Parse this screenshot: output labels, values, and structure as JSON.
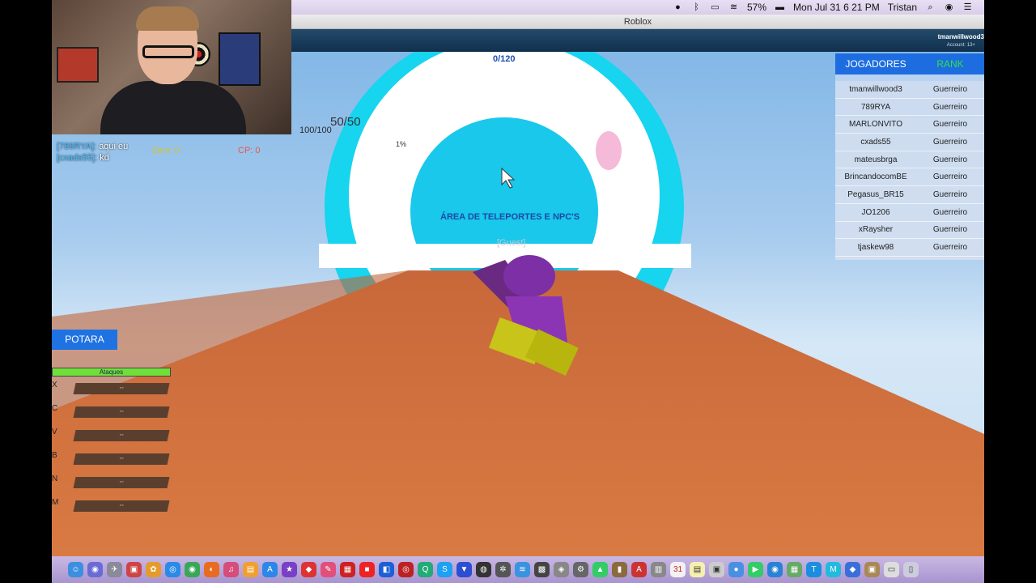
{
  "menubar": {
    "battery": "57%",
    "datetime": "Mon Jul 31  6 21 PM",
    "user": "Tristan"
  },
  "window": {
    "title": "Roblox"
  },
  "account": {
    "username": "tmanwillwood3",
    "age": "Account: 13+"
  },
  "hud": {
    "health": "100/100",
    "ki": "50/50",
    "percent": "1%",
    "zeni": "Zeni: 0",
    "cp": "CP: 0",
    "counter": "0/120",
    "area_label": "ÁREA DE TELEPORTES E NPC'S",
    "guest_label": "[Guest]"
  },
  "chat": [
    {
      "name": "[789RYA]:",
      "text": "aqui eu"
    },
    {
      "name": "[cxads55]:",
      "text": "kd"
    }
  ],
  "potara": {
    "label": "POTARA"
  },
  "attacks": {
    "title": "Ataques",
    "rows": [
      {
        "key": "X",
        "value": "--"
      },
      {
        "key": "C",
        "value": "--"
      },
      {
        "key": "V",
        "value": "--"
      },
      {
        "key": "B",
        "value": "--"
      },
      {
        "key": "N",
        "value": "--"
      },
      {
        "key": "M",
        "value": "--"
      }
    ]
  },
  "playerlist": {
    "col_players": "JOGADORES",
    "col_rank": "RANK",
    "rows": [
      {
        "name": "tmanwillwood3",
        "rank": "Guerreiro"
      },
      {
        "name": "789RYA",
        "rank": "Guerreiro"
      },
      {
        "name": "MARLONVITO",
        "rank": "Guerreiro"
      },
      {
        "name": "cxads55",
        "rank": "Guerreiro"
      },
      {
        "name": "mateusbrga",
        "rank": "Guerreiro"
      },
      {
        "name": "BrincandocomBE",
        "rank": "Guerreiro"
      },
      {
        "name": "Pegasus_BR15",
        "rank": "Guerreiro"
      },
      {
        "name": "JO1206",
        "rank": "Guerreiro"
      },
      {
        "name": "xRaysher",
        "rank": "Guerreiro"
      },
      {
        "name": "tjaskew98",
        "rank": "Guerreiro"
      }
    ]
  },
  "colors": {
    "portal_cyan": "#17d4ef",
    "ground_orange": "#d8733d",
    "playerlist_header": "#1d6de0"
  }
}
